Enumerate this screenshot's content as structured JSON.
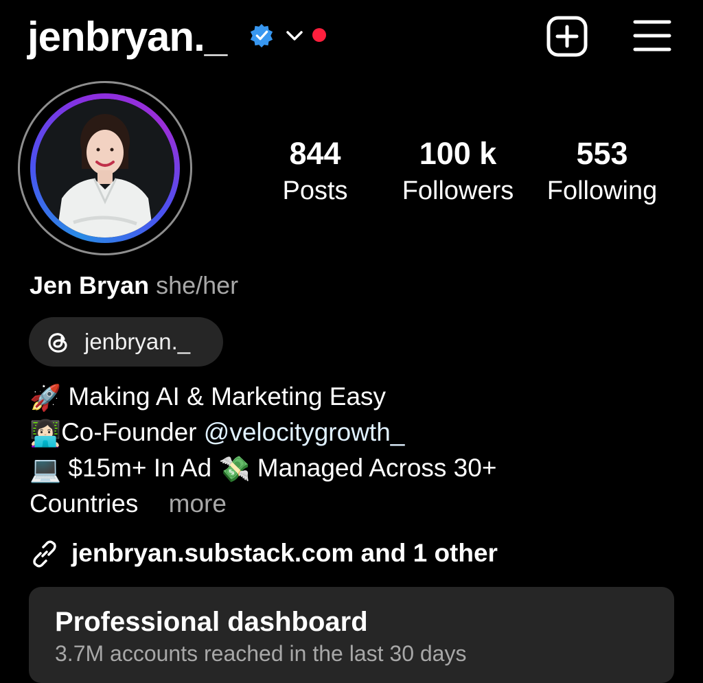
{
  "header": {
    "username": "jenbryan._",
    "verified_icon": "verified-badge-icon",
    "switch_icon": "chevron-down-icon",
    "notification_dot_color": "#ff1f3d",
    "create_icon": "plus-square-icon",
    "menu_icon": "hamburger-menu-icon"
  },
  "avatar": {
    "ring_colors": [
      "#2a8be5",
      "#8a2fe0"
    ]
  },
  "stats": [
    {
      "value": "844",
      "label": "Posts"
    },
    {
      "value": "100 k",
      "label": "Followers"
    },
    {
      "value": "553",
      "label": "Following"
    }
  ],
  "profile": {
    "name": "Jen Bryan",
    "pronouns": "she/her",
    "threads_handle": "jenbryan._",
    "threads_icon": "threads-icon"
  },
  "bio": {
    "line1": "Making AI & Marketing Easy",
    "line1_emoji": "🚀",
    "line2_prefix": "Co-Founder ",
    "line2_mention": "@velocitygrowth_",
    "line2_emoji": "👩🏻‍💻",
    "line3_text_a": "$15m+ In Ad ",
    "line3_emoji": "💸",
    "line3_text_b": " Managed Across 30+",
    "line3_emoji_lead": "💻",
    "line4": "Countries",
    "more": "more"
  },
  "link": {
    "icon": "link-icon",
    "text": "jenbryan.substack.com and 1 other"
  },
  "dashboard": {
    "title": "Professional dashboard",
    "subtitle": "3.7M accounts reached in the last 30 days"
  }
}
